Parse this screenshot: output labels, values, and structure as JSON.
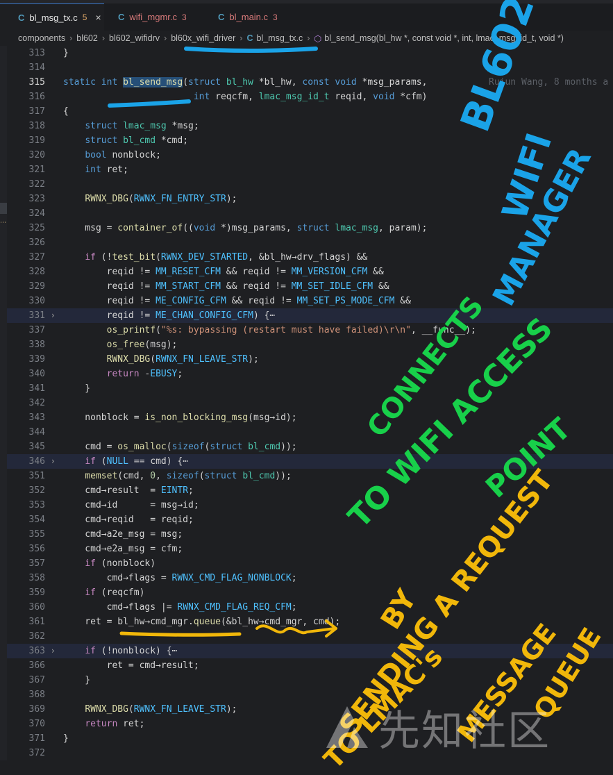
{
  "tabs": [
    {
      "label": "bl_msg_tx.c",
      "count": "5",
      "active": true
    },
    {
      "label": "wifi_mgmr.c",
      "count": "3",
      "active": false
    },
    {
      "label": "bl_main.c",
      "count": "3",
      "active": false
    }
  ],
  "breadcrumb": [
    "components",
    "bl602",
    "bl602_wifidrv",
    "bl60x_wifi_driver",
    "bl_msg_tx.c",
    "bl_send_msg(bl_hw *, const void *, int, lmac_msg_id_t, void *)"
  ],
  "icons": {
    "file_icon": "C",
    "close_icon": "×",
    "fold_icon": "›",
    "symbol_icon": "⬡"
  },
  "blame": "Ruiun Wang, 8 months a",
  "line_numbers": [
    "313",
    "314",
    "315",
    "316",
    "317",
    "318",
    "319",
    "320",
    "321",
    "322",
    "323",
    "324",
    "325",
    "326",
    "327",
    "328",
    "329",
    "330",
    "331",
    "337",
    "338",
    "339",
    "340",
    "341",
    "342",
    "343",
    "344",
    "345",
    "346",
    "351",
    "352",
    "353",
    "354",
    "355",
    "356",
    "357",
    "358",
    "359",
    "360",
    "361",
    "362",
    "363",
    "366",
    "367",
    "368",
    "369",
    "370",
    "371",
    "372"
  ],
  "annotations": {
    "blue": [
      "BL602",
      "WIFI",
      "MANAGER"
    ],
    "green": [
      "CONNECTS",
      "TO WIFI ACCESS",
      "POINT"
    ],
    "yellow": [
      "BY",
      "SENDING A REQUEST",
      "TO LMAC's",
      "MESSAGE",
      "QUEUE"
    ]
  },
  "watermark": "先知社区",
  "colors": {
    "accent": "#3b76c7",
    "blue_ink": "#1aa3e8",
    "green_ink": "#18d04a",
    "yellow_ink": "#f1b70a"
  }
}
